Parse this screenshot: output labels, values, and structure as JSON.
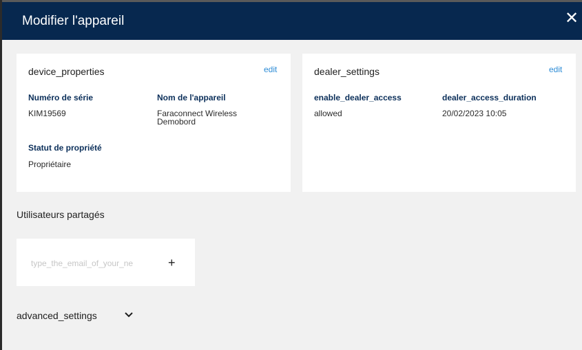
{
  "dialog": {
    "title": "Modifier l'appareil",
    "close_icon": "close-icon"
  },
  "device_properties": {
    "title": "device_properties",
    "edit_label": "edit",
    "serial_label": "Numéro de série",
    "serial_value": "KIM19569",
    "name_label": "Nom de l'appareil",
    "name_value_line1": "Faraconnect Wireless",
    "name_value_line2": "Demobord",
    "ownership_label": "Statut de propriété",
    "ownership_value": "Propriétaire"
  },
  "dealer_settings": {
    "title": "dealer_settings",
    "edit_label": "edit",
    "access_label": "enable_dealer_access",
    "access_value": "allowed",
    "duration_label": "dealer_access_duration",
    "duration_value": "20/02/2023 10:05"
  },
  "shared_users": {
    "title": "Utilisateurs partagés",
    "email_placeholder": "type_the_email_of_your_ne",
    "add_label": "+"
  },
  "advanced_settings": {
    "label": "advanced_settings",
    "icon": "chevron-down-icon"
  },
  "colors": {
    "header_bg": "#07284f",
    "link": "#2d8cd6",
    "label": "#0b2f5a",
    "panel_bg": "#f1f1f1"
  }
}
